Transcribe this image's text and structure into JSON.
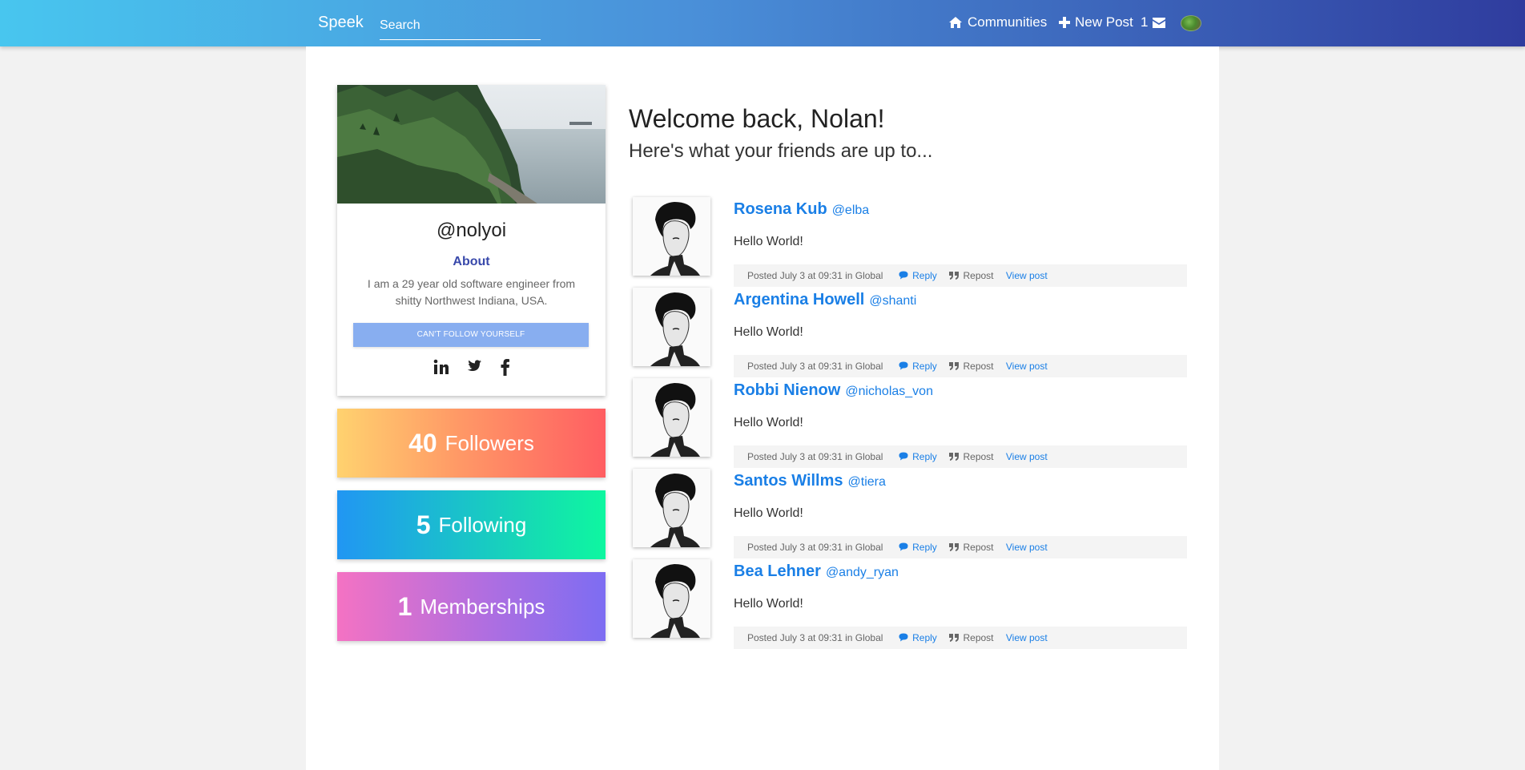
{
  "nav": {
    "brand": "Speek",
    "search_placeholder": "Search",
    "communities": "Communities",
    "new_post": "New Post",
    "mail_count": "1"
  },
  "profile": {
    "handle": "@nolyoi",
    "about_heading": "About",
    "about_text": "I am a 29 year old software engineer from shitty Northwest Indiana, USA.",
    "follow_button": "CAN'T FOLLOW YOURSELF",
    "social": [
      "linkedin-icon",
      "twitter-icon",
      "facebook-icon"
    ]
  },
  "stats": {
    "followers": {
      "count": "40",
      "label": "Followers"
    },
    "following": {
      "count": "5",
      "label": "Following"
    },
    "memberships": {
      "count": "1",
      "label": "Memberships"
    }
  },
  "feed": {
    "welcome": "Welcome back, Nolan!",
    "subheading": "Here's what your friends are up to...",
    "posts": [
      {
        "name": "Rosena Kub",
        "username": "@elba",
        "body": "Hello World!",
        "meta": "Posted July 3 at 09:31 in Global",
        "reply": "Reply",
        "repost": "Repost",
        "view": "View post"
      },
      {
        "name": "Argentina Howell",
        "username": "@shanti",
        "body": "Hello World!",
        "meta": "Posted July 3 at 09:31 in Global",
        "reply": "Reply",
        "repost": "Repost",
        "view": "View post"
      },
      {
        "name": "Robbi Nienow",
        "username": "@nicholas_von",
        "body": "Hello World!",
        "meta": "Posted July 3 at 09:31 in Global",
        "reply": "Reply",
        "repost": "Repost",
        "view": "View post"
      },
      {
        "name": "Santos Willms",
        "username": "@tiera",
        "body": "Hello World!",
        "meta": "Posted July 3 at 09:31 in Global",
        "reply": "Reply",
        "repost": "Repost",
        "view": "View post"
      },
      {
        "name": "Bea Lehner",
        "username": "@andy_ryan",
        "body": "Hello World!",
        "meta": "Posted July 3 at 09:31 in Global",
        "reply": "Reply",
        "repost": "Repost",
        "view": "View post"
      }
    ]
  },
  "colors": {
    "nav_gradient_start": "#48c6ef",
    "nav_gradient_end": "#2f3c9e",
    "link_blue": "#1a7fe6",
    "about_heading": "#3949ab",
    "follow_button": "#88aef0"
  }
}
